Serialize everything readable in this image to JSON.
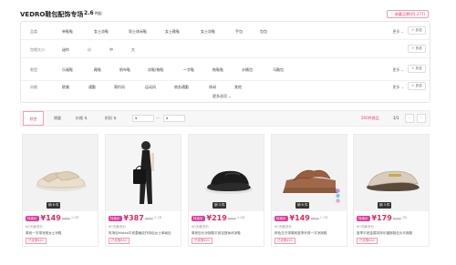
{
  "header": {
    "brand": "VEDRO鞋包配饰专场",
    "count": "2.6",
    "count_unit": "件起",
    "favorite": "♡ 收藏品牌(65,377)"
  },
  "filters": [
    {
      "label": "品类",
      "options": [
        "单鞋鞋",
        "女士凉鞋",
        "男士休闲鞋",
        "女士靴鞋",
        "女士凉鞋",
        "手包",
        "包包"
      ],
      "more": "更多 ⌄",
      "multi": "+ 多选"
    },
    {
      "label": "包袋大小",
      "options": [
        "迷你",
        "小",
        "中",
        "大"
      ],
      "more": "",
      "multi": "+ 多选"
    },
    {
      "label": "款型",
      "options": [
        "乐福鞋",
        "靴鞋",
        "帆布鞋",
        "凉鞋/拖鞋",
        "一字鞋",
        "拖鞋鞋",
        "水桶包",
        "马鞍包"
      ],
      "more": "更多 ⌄",
      "multi": "+ 多选"
    },
    {
      "label": "风格",
      "options": [
        "欧美",
        "通勤",
        "简约风",
        "运动风",
        "商务通勤",
        "休闲",
        "其他"
      ],
      "more": "更多 ⌄",
      "multi": "+ 多选"
    }
  ],
  "more_options": "更多选项 ⌄",
  "sort": {
    "tabs": [
      "综合",
      "销量",
      "价格 ⇅",
      "折扣 ⇅"
    ],
    "price_from_placeholder": "¥",
    "price_sep": "—",
    "price_to_placeholder": "¥",
    "result": "200件商品",
    "page": "1/1",
    "prev": "‹",
    "next": "›"
  },
  "products": [
    {
      "badge": "特卖价",
      "price": "¥149",
      "original": "¥489",
      "discount": "3.4折",
      "lowest": "60天最低价",
      "title": "厚底一字带凉拖女士凉鞋",
      "coupon": "已优惠¥20",
      "tag": "销 6 件"
    },
    {
      "badge": "特卖价",
      "price": "¥387",
      "original": "¥939",
      "discount": "4.1折",
      "lowest": "60天最低价",
      "title": "牧场包Mateo平底菱格纹托特包女士单肩包",
      "coupon": "已优惠¥20",
      "tag": ""
    },
    {
      "badge": "特卖价",
      "price": "¥219",
      "original": "¥499",
      "discount": "4.4折",
      "lowest": "60天最低价",
      "title": "厚底包头凉拖鞋平底百搭休闲凉鞋",
      "coupon": "已优惠¥20",
      "tag": "销 3 件"
    },
    {
      "badge": "特卖价",
      "price": "¥149",
      "original": "¥939",
      "discount": "1.7折",
      "lowest": "60天最低价",
      "title": "棕色交叉带厚底夏季外穿一字凉拖鞋",
      "coupon": "已优惠¥20",
      "tag": "销 6 件"
    },
    {
      "badge": "特卖价",
      "price": "¥179",
      "original": "¥499",
      "discount": "3折",
      "lowest": "60天最低价",
      "title": "夏季平底金属扣饰乐福拖鞋包头半拖鞋",
      "coupon": "已优惠¥20",
      "tag": "销 3 件"
    }
  ]
}
